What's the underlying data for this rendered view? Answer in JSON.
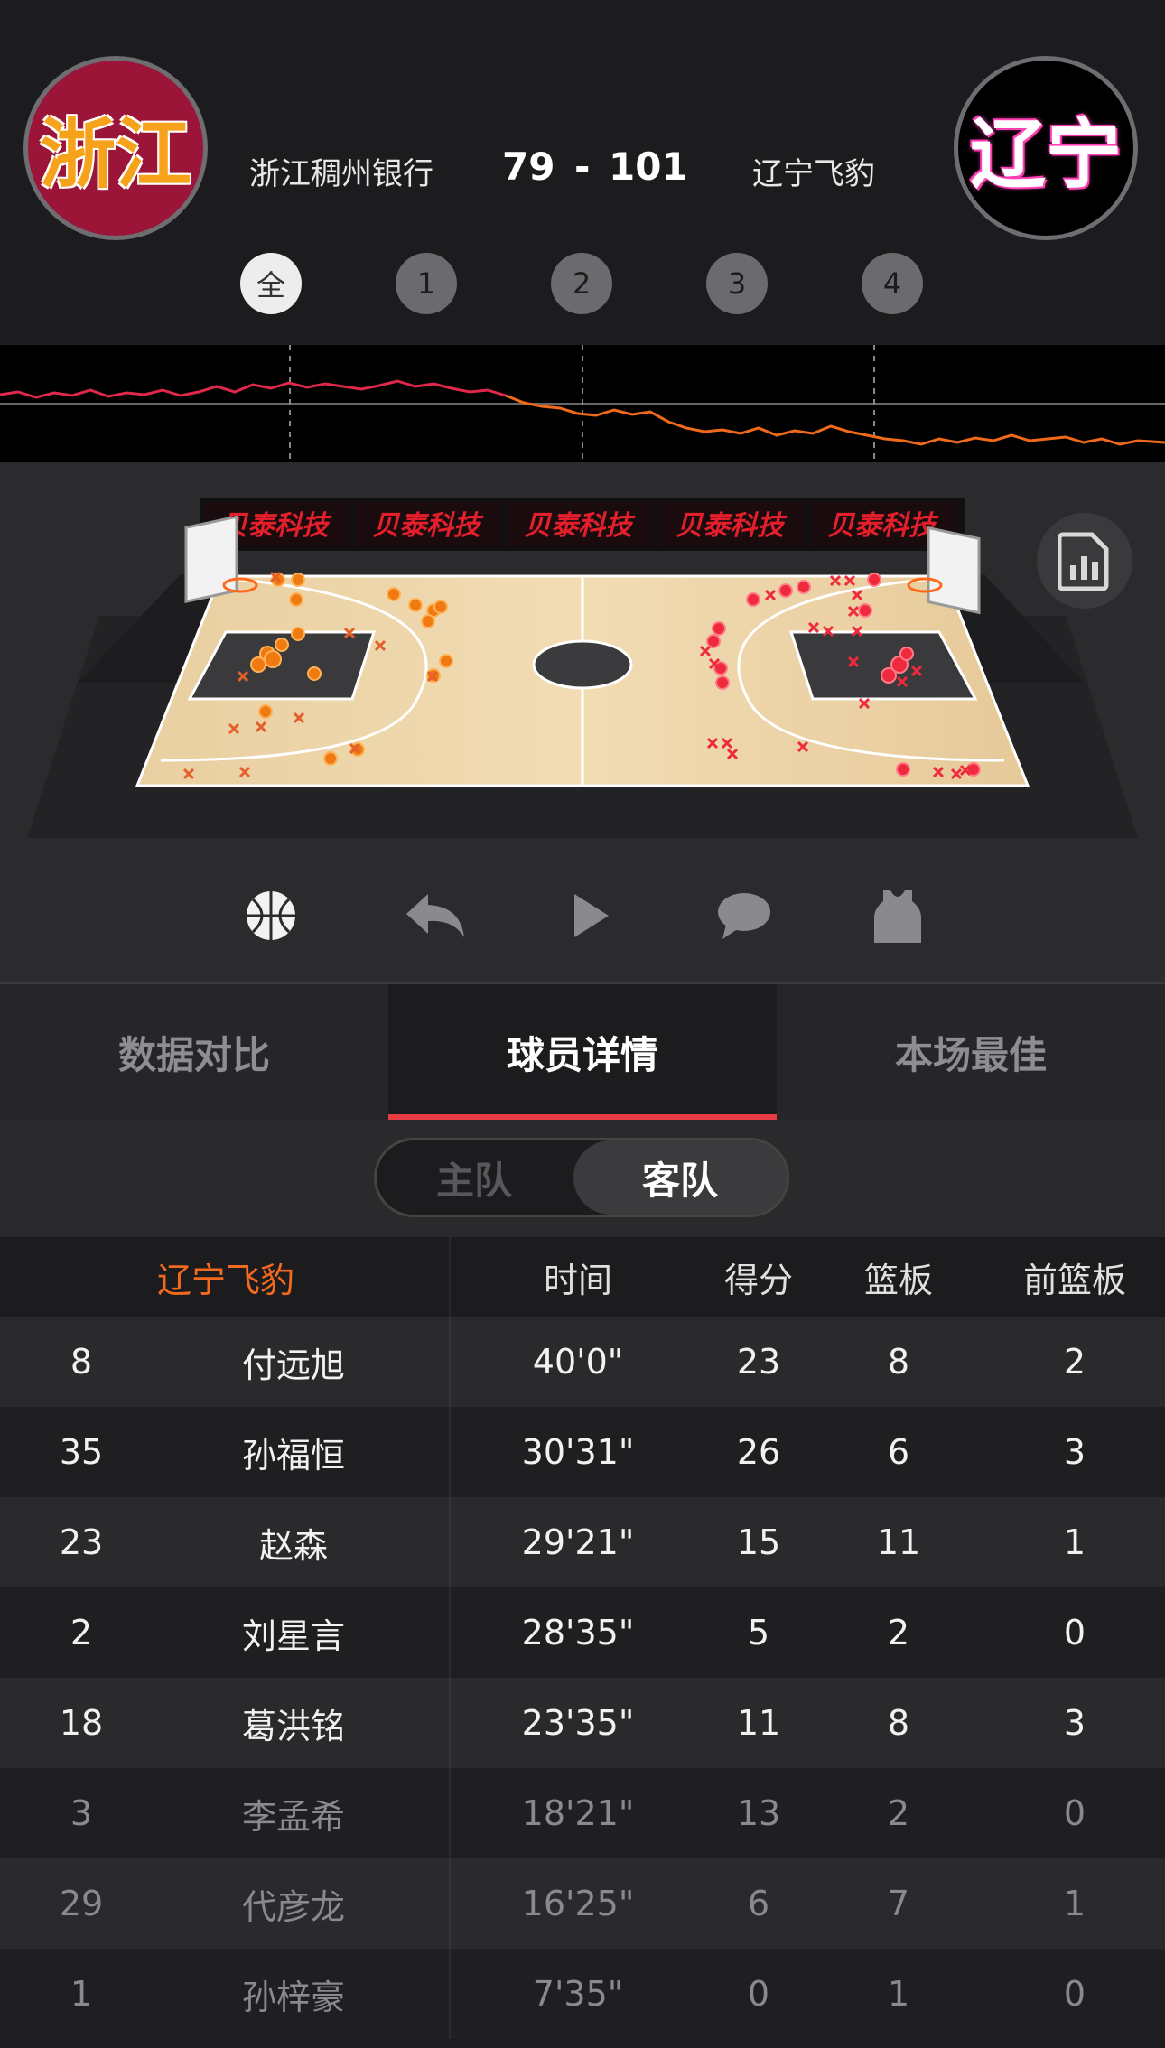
{
  "header": {
    "home_logo_text": "浙江",
    "away_logo_text": "辽宁",
    "home_team": "浙江稠州银行",
    "away_team": "辽宁飞豹",
    "home_score": "79",
    "separator": "-",
    "away_score": "101"
  },
  "quarters": [
    "全",
    "1",
    "2",
    "3",
    "4"
  ],
  "court": {
    "sponsor_boards": [
      "贝泰科技",
      "贝泰科技",
      "贝泰科技",
      "贝泰科技",
      "贝泰科技"
    ]
  },
  "toolbar": [
    "basketball-icon",
    "rewind-icon",
    "play-icon",
    "comment-icon",
    "jersey-icon"
  ],
  "tabs": {
    "compare": "数据对比",
    "players": "球员详情",
    "best": "本场最佳"
  },
  "toggle": {
    "home": "主队",
    "away": "客队"
  },
  "table": {
    "team_header": "辽宁飞豹",
    "columns": [
      "时间",
      "得分",
      "篮板",
      "前篮板"
    ],
    "rows": [
      {
        "num": "8",
        "name": "付远旭",
        "time": "40'0\"",
        "pts": "23",
        "reb": "8",
        "oreb": "2",
        "starter": true
      },
      {
        "num": "35",
        "name": "孙福恒",
        "time": "30'31\"",
        "pts": "26",
        "reb": "6",
        "oreb": "3",
        "starter": true
      },
      {
        "num": "23",
        "name": "赵森",
        "time": "29'21\"",
        "pts": "15",
        "reb": "11",
        "oreb": "1",
        "starter": true
      },
      {
        "num": "2",
        "name": "刘星言",
        "time": "28'35\"",
        "pts": "5",
        "reb": "2",
        "oreb": "0",
        "starter": true
      },
      {
        "num": "18",
        "name": "葛洪铭",
        "time": "23'35\"",
        "pts": "11",
        "reb": "8",
        "oreb": "3",
        "starter": true
      },
      {
        "num": "3",
        "name": "李孟希",
        "time": "18'21\"",
        "pts": "13",
        "reb": "2",
        "oreb": "0",
        "starter": false
      },
      {
        "num": "29",
        "name": "代彦龙",
        "time": "16'25\"",
        "pts": "6",
        "reb": "7",
        "oreb": "1",
        "starter": false
      },
      {
        "num": "1",
        "name": "孙梓豪",
        "time": "7'35\"",
        "pts": "0",
        "reb": "1",
        "oreb": "0",
        "starter": false
      }
    ]
  },
  "colors": {
    "home_logo_bg": "#9b1538",
    "away_logo_bg": "#000000",
    "accent_red": "#e83c45",
    "team_header": "#f36a1f",
    "home_line": "#e0284a",
    "away_line": "#f06a1a"
  }
}
